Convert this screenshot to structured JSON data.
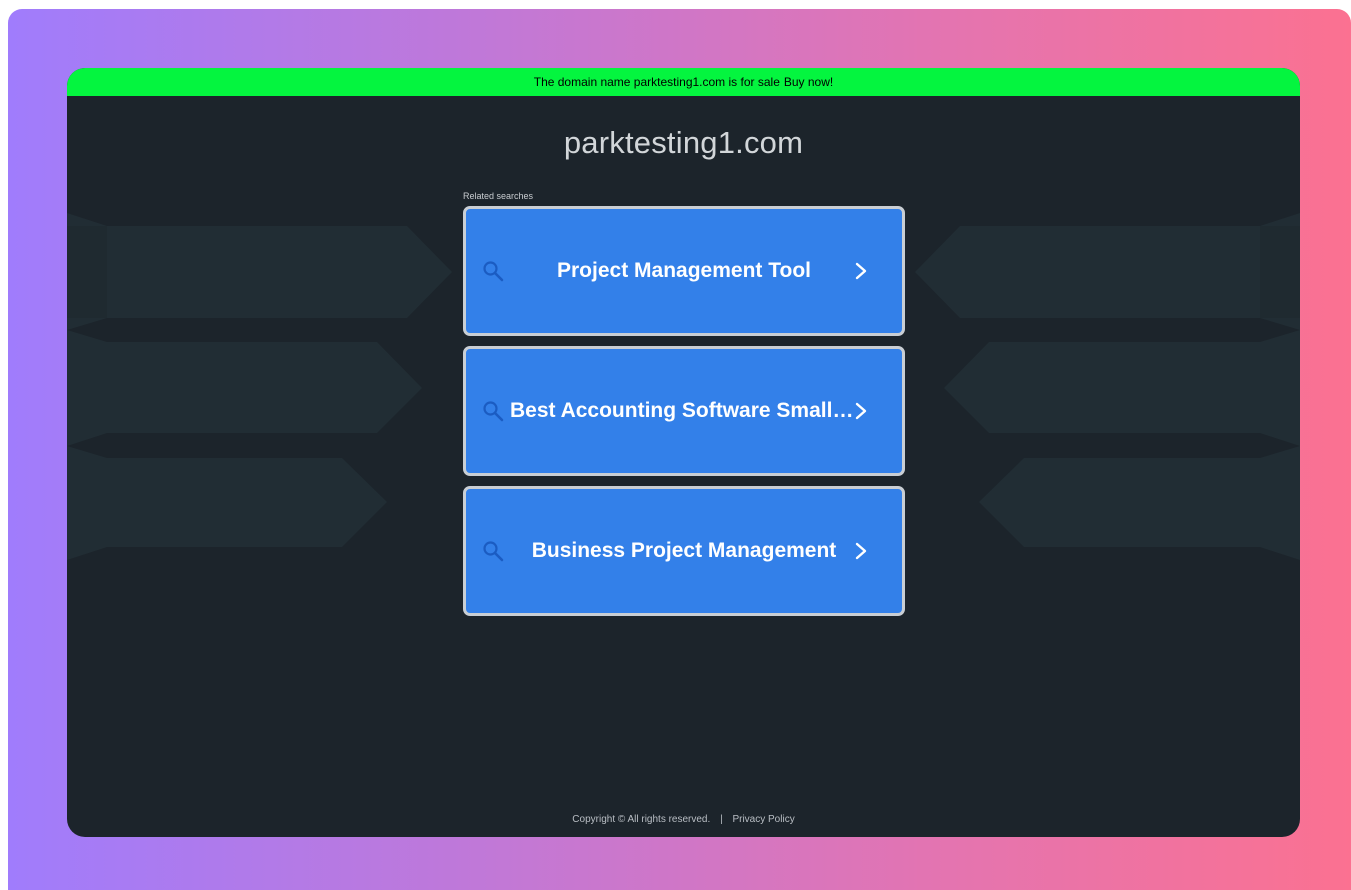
{
  "banner": {
    "text": "The domain name parktesting1.com is for sale",
    "link_label": "Buy now!"
  },
  "domain": {
    "title": "parktesting1.com"
  },
  "related": {
    "heading": "Related searches",
    "items": [
      {
        "label": "Project Management Tool",
        "icon": "search-icon"
      },
      {
        "label": "Best Accounting Software Small Business",
        "icon": "search-icon"
      },
      {
        "label": "Business Project Management",
        "icon": "search-icon"
      }
    ]
  },
  "footer": {
    "copyright": "Copyright © All rights reserved.",
    "separator": "|",
    "privacy_label": "Privacy Policy"
  },
  "colors": {
    "banner_bg": "#04f53f",
    "page_bg": "#1c242b",
    "card_bg": "#3380e9",
    "card_border": "#c9ced4",
    "gradient_start": "#a07cfc",
    "gradient_end": "#fb7191"
  }
}
